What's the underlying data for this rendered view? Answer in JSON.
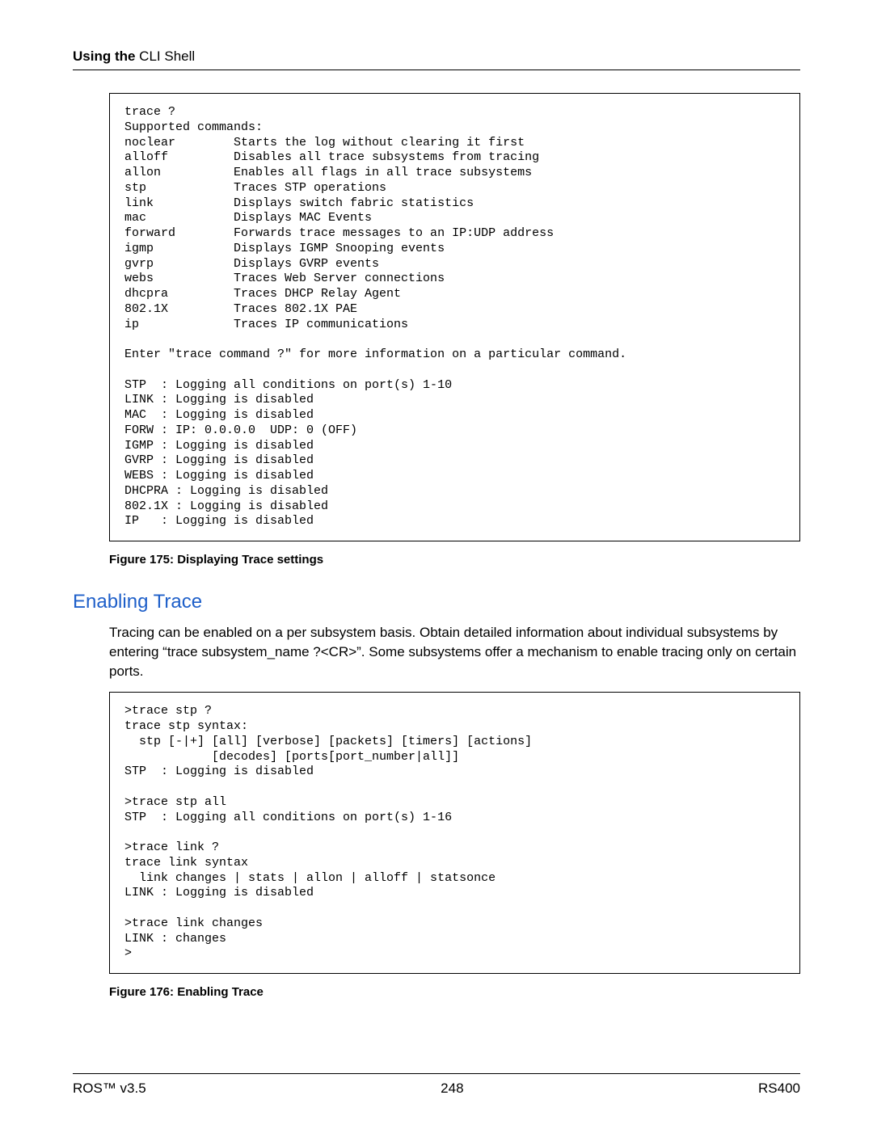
{
  "header": {
    "bold": "Using the ",
    "rest": "CLI Shell"
  },
  "codebox1": "trace ?\nSupported commands:\nnoclear        Starts the log without clearing it first\nalloff         Disables all trace subsystems from tracing\nallon          Enables all flags in all trace subsystems\nstp            Traces STP operations\nlink           Displays switch fabric statistics\nmac            Displays MAC Events\nforward        Forwards trace messages to an IP:UDP address\nigmp           Displays IGMP Snooping events\ngvrp           Displays GVRP events\nwebs           Traces Web Server connections\ndhcpra         Traces DHCP Relay Agent\n802.1X         Traces 802.1X PAE\nip             Traces IP communications\n\nEnter \"trace command ?\" for more information on a particular command.\n\nSTP  : Logging all conditions on port(s) 1-10\nLINK : Logging is disabled\nMAC  : Logging is disabled\nFORW : IP: 0.0.0.0  UDP: 0 (OFF)\nIGMP : Logging is disabled\nGVRP : Logging is disabled\nWEBS : Logging is disabled\nDHCPRA : Logging is disabled\n802.1X : Logging is disabled\nIP   : Logging is disabled",
  "caption1": "Figure 175: Displaying Trace settings",
  "section_heading": "Enabling Trace",
  "body_para": "Tracing can be enabled on a per subsystem basis. Obtain detailed information about individual subsystems by entering “trace subsystem_name ?<CR>”. Some subsystems offer a mechanism to enable tracing only on certain ports.",
  "codebox2": ">trace stp ?\ntrace stp syntax:\n  stp [-|+] [all] [verbose] [packets] [timers] [actions]\n            [decodes] [ports[port_number|all]]\nSTP  : Logging is disabled\n\n>trace stp all\nSTP  : Logging all conditions on port(s) 1-16\n\n>trace link ?\ntrace link syntax\n  link changes | stats | allon | alloff | statsonce\nLINK : Logging is disabled\n\n>trace link changes\nLINK : changes\n>",
  "caption2": "Figure 176: Enabling Trace",
  "footer": {
    "left": "ROS™  v3.5",
    "center": "248",
    "right": "RS400"
  }
}
